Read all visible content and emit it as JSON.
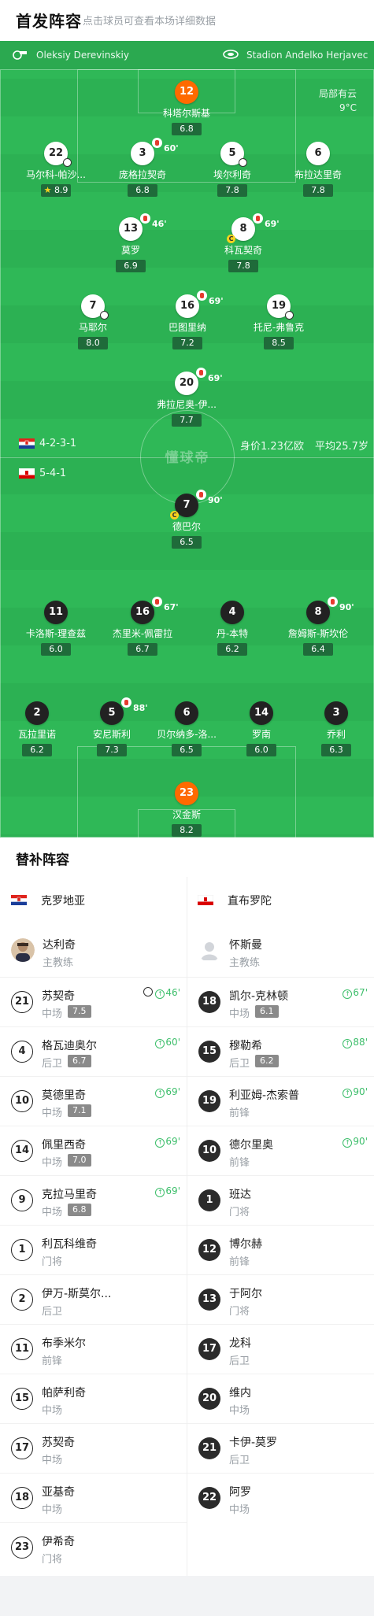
{
  "header": {
    "title": "首发阵容",
    "subtitle": "点击球员可查看本场详细数据"
  },
  "match": {
    "referee": "Oleksiy Derevinskiy",
    "stadium": "Stadion Anđelko Herjavec",
    "weather": "局部有云",
    "temperature": "9°C",
    "center_logo": "懂球帝"
  },
  "home_formation": {
    "formation": "4-2-3-1",
    "value": "身价1.23亿欧",
    "avg_age": "平均25.7岁"
  },
  "away_formation": {
    "formation": "5-4-1"
  },
  "home_players": [
    {
      "num": "12",
      "name": "科塔尔斯基",
      "score": "6.8",
      "style": "o"
    },
    {
      "num": "22",
      "name": "马尔科-帕沙...",
      "score": "8.9",
      "star": "★",
      "style": "w"
    },
    {
      "num": "3",
      "name": "庞格拉契奇",
      "score": "6.8",
      "sub": "60'",
      "style": "w"
    },
    {
      "num": "5",
      "name": "埃尔利奇",
      "score": "7.8",
      "style": "w"
    },
    {
      "num": "6",
      "name": "布拉达里奇",
      "score": "7.8",
      "style": "w"
    },
    {
      "num": "13",
      "name": "莫罗",
      "score": "6.9",
      "sub": "46'",
      "style": "w"
    },
    {
      "num": "8",
      "name": "科瓦契奇",
      "score": "7.8",
      "sub": "69'",
      "ycard": "C",
      "style": "w"
    },
    {
      "num": "7",
      "name": "马耶尔",
      "score": "8.0",
      "style": "w"
    },
    {
      "num": "16",
      "name": "巴图里纳",
      "score": "7.2",
      "sub": "69'",
      "style": "w"
    },
    {
      "num": "19",
      "name": "托尼-弗鲁克",
      "score": "8.5",
      "style": "w"
    },
    {
      "num": "20",
      "name": "弗拉尼奥-伊...",
      "score": "7.7",
      "sub": "69'",
      "style": "w"
    }
  ],
  "away_players": [
    {
      "num": "7",
      "name": "德巴尔",
      "score": "6.5",
      "sub": "90'",
      "ycard": "C",
      "style": "k"
    },
    {
      "num": "11",
      "name": "卡洛斯-理查兹",
      "score": "6.0",
      "style": "k"
    },
    {
      "num": "16",
      "name": "杰里米-佩雷拉",
      "score": "6.7",
      "sub": "67'",
      "style": "k"
    },
    {
      "num": "4",
      "name": "丹-本特",
      "score": "6.2",
      "style": "k"
    },
    {
      "num": "8",
      "name": "詹姆斯-斯坎伦",
      "score": "6.4",
      "sub": "90'",
      "style": "k"
    },
    {
      "num": "2",
      "name": "瓦拉里诺",
      "score": "6.2",
      "style": "k"
    },
    {
      "num": "5",
      "name": "安尼斯利",
      "score": "7.3",
      "sub": "88'",
      "style": "k"
    },
    {
      "num": "6",
      "name": "贝尔纳多-洛...",
      "score": "6.5",
      "style": "k"
    },
    {
      "num": "14",
      "name": "罗南",
      "score": "6.0",
      "style": "k"
    },
    {
      "num": "3",
      "name": "乔利",
      "score": "6.3",
      "style": "k"
    },
    {
      "num": "23",
      "name": "汉金斯",
      "score": "8.2",
      "style": "o"
    }
  ],
  "subs": {
    "title": "替补阵容",
    "home_team": "克罗地亚",
    "away_team": "直布罗陀",
    "home_coach": {
      "name": "达利奇",
      "role": "主教练"
    },
    "away_coach": {
      "name": "怀斯曼",
      "role": "主教练"
    },
    "home": [
      {
        "num": "21",
        "name": "苏契奇",
        "pos": "中场",
        "score": "7.5",
        "in": "46'",
        "goal": true
      },
      {
        "num": "4",
        "name": "格瓦迪奥尔",
        "pos": "后卫",
        "score": "6.7",
        "in": "60'"
      },
      {
        "num": "10",
        "name": "莫德里奇",
        "pos": "中场",
        "score": "7.1",
        "in": "69'"
      },
      {
        "num": "14",
        "name": "佩里西奇",
        "pos": "中场",
        "score": "7.0",
        "in": "69'"
      },
      {
        "num": "9",
        "name": "克拉马里奇",
        "pos": "中场",
        "score": "6.8",
        "in": "69'"
      },
      {
        "num": "1",
        "name": "利瓦科维奇",
        "pos": "门将"
      },
      {
        "num": "2",
        "name": "伊万-斯莫尔...",
        "pos": "后卫"
      },
      {
        "num": "11",
        "name": "布季米尔",
        "pos": "前锋"
      },
      {
        "num": "15",
        "name": "帕萨利奇",
        "pos": "中场"
      },
      {
        "num": "17",
        "name": "苏契奇",
        "pos": "中场"
      },
      {
        "num": "18",
        "name": "亚基奇",
        "pos": "中场"
      },
      {
        "num": "23",
        "name": "伊希奇",
        "pos": "门将"
      }
    ],
    "away": [
      {
        "num": "18",
        "name": "凯尔-克林顿",
        "pos": "中场",
        "score": "6.1",
        "in": "67'"
      },
      {
        "num": "15",
        "name": "穆勒希",
        "pos": "后卫",
        "score": "6.2",
        "in": "88'"
      },
      {
        "num": "19",
        "name": "利亚姆-杰索普",
        "pos": "前锋",
        "in": "90'"
      },
      {
        "num": "10",
        "name": "德尔里奥",
        "pos": "前锋",
        "in": "90'"
      },
      {
        "num": "1",
        "name": "班达",
        "pos": "门将"
      },
      {
        "num": "12",
        "name": "博尔赫",
        "pos": "前锋"
      },
      {
        "num": "13",
        "name": "于阿尔",
        "pos": "门将"
      },
      {
        "num": "17",
        "name": "龙科",
        "pos": "后卫"
      },
      {
        "num": "20",
        "name": "维内",
        "pos": "中场"
      },
      {
        "num": "21",
        "name": "卡伊-莫罗",
        "pos": "后卫"
      },
      {
        "num": "22",
        "name": "阿罗",
        "pos": "中场"
      }
    ]
  }
}
